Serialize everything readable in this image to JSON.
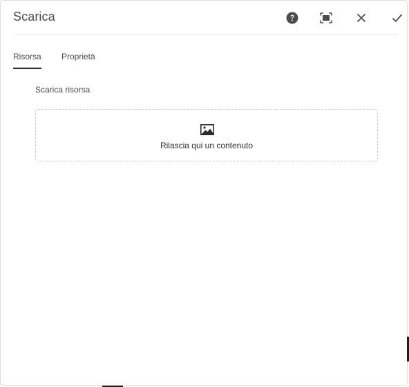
{
  "dialog": {
    "title": "Scarica",
    "actions": [
      {
        "name": "help",
        "icon": "help-icon"
      },
      {
        "name": "fullscreen",
        "icon": "fullscreen-icon"
      },
      {
        "name": "cancel",
        "icon": "close-icon"
      },
      {
        "name": "done",
        "icon": "check-icon"
      }
    ]
  },
  "tabs": [
    {
      "label": "Risorsa",
      "active": true
    },
    {
      "label": "Proprietà",
      "active": false
    }
  ],
  "field": {
    "label": "Scarica risorsa"
  },
  "dropzone": {
    "icon": "image-icon",
    "text": "Rilascia qui un contenuto"
  },
  "colors": {
    "text": "#4b4b4b",
    "text_dark": "#2c2c2c",
    "icon": "#4b4b4b",
    "divider": "#e6e6e6",
    "dropzone_border": "#c8c8c8"
  }
}
